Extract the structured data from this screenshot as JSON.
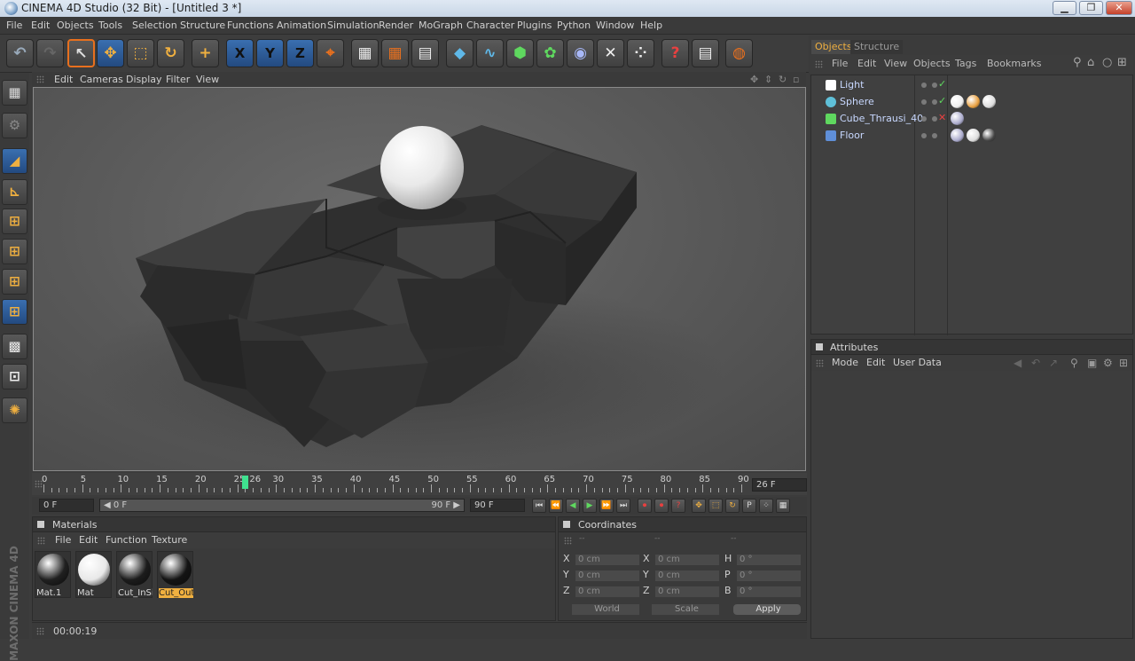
{
  "window": {
    "title": "CINEMA 4D Studio (32 Bit) - [Untitled 3 *]",
    "minimize": "▁",
    "maximize": "❐",
    "close": "✕"
  },
  "menu": [
    "File",
    "Edit",
    "Objects",
    "Tools",
    "Selection",
    "Structure",
    "Functions",
    "Animation",
    "Simulation",
    "Render",
    "MoGraph",
    "Character",
    "Plugins",
    "Python",
    "Window",
    "Help"
  ],
  "toolbar": {
    "undo": "↶",
    "redo": "↷",
    "live_select": "↖",
    "move": "✥",
    "scale": "⬚",
    "rotate": "↻",
    "add": "+",
    "x_axis": "X",
    "y_axis": "Y",
    "z_axis": "Z",
    "coord_system": "⌖",
    "render_view": "▦",
    "render_pv": "▦",
    "render_settings": "▤",
    "cube": "◆",
    "spline": "∿",
    "nurbs": "⬢",
    "array": "✿",
    "deformer": "◉",
    "scene": "✕",
    "particles": "⁘",
    "help": "?",
    "layer": "▤",
    "web": "◍"
  },
  "left_tools": [
    "▦",
    "⚙",
    "◢",
    "⊾",
    "⊞",
    "⊞",
    "⊞",
    "⊞",
    "▩",
    "⊡",
    "✺"
  ],
  "brand": "MAXON CINEMA 4D",
  "viewport": {
    "menu": [
      "Edit",
      "Cameras",
      "Display",
      "Filter",
      "View"
    ]
  },
  "timeline": {
    "labels": [
      "0",
      "5",
      "10",
      "15",
      "20",
      "25",
      "30",
      "35",
      "40",
      "45",
      "50",
      "55",
      "60",
      "65",
      "70",
      "75",
      "80",
      "85",
      "90"
    ],
    "current_label": "26",
    "current_frame": 26,
    "max_frame": 90,
    "frame_field": "26 F"
  },
  "controls": {
    "start": "0 F",
    "range_start": "◀ 0 F",
    "range_end": "90 F ▶",
    "end": "90 F",
    "playback": [
      "⏮",
      "⏪",
      "◀",
      "▶",
      "⏩",
      "⏭"
    ],
    "keys": [
      "⏺",
      "⏺",
      "?",
      "✥",
      "⬚",
      "↻",
      "P",
      "⁘",
      "▦"
    ]
  },
  "materials": {
    "title": "Materials",
    "menu": [
      "File",
      "Edit",
      "Function",
      "Texture"
    ],
    "items": [
      {
        "label": "Mat.1",
        "color": "#202020"
      },
      {
        "label": "Mat",
        "color": "#e8e8e8"
      },
      {
        "label": "Cut_InSi",
        "color": "#1c1c1c"
      },
      {
        "label": "Cut_Out.",
        "color": "#141414",
        "selected": true
      }
    ]
  },
  "coordinates": {
    "title": "Coordinates",
    "heads": [
      "--",
      "--",
      "--"
    ],
    "rows": [
      {
        "a": "X",
        "av": "0 cm",
        "b": "X",
        "bv": "0 cm",
        "c": "H",
        "cv": "0 °"
      },
      {
        "a": "Y",
        "av": "0 cm",
        "b": "Y",
        "bv": "0 cm",
        "c": "P",
        "cv": "0 °"
      },
      {
        "a": "Z",
        "av": "0 cm",
        "b": "Z",
        "bv": "0 cm",
        "c": "B",
        "cv": "0 °"
      }
    ],
    "world": "World",
    "scale": "Scale",
    "apply": "Apply"
  },
  "status": {
    "time": "00:00:19"
  },
  "objects_panel": {
    "tabs": [
      "Objects",
      "Structure"
    ],
    "menu": [
      "File",
      "Edit",
      "View",
      "Objects",
      "Tags",
      "Bookmarks"
    ],
    "items": [
      {
        "name": "Light",
        "icon_color": "#ffffff"
      },
      {
        "name": "Sphere",
        "icon_color": "#5fc0d8"
      },
      {
        "name": "Cube_Thrausi_40",
        "icon_color": "#5fd85f"
      },
      {
        "name": "Floor",
        "icon_color": "#5f8fd8"
      }
    ]
  },
  "attributes": {
    "title": "Attributes",
    "menu": [
      "Mode",
      "Edit",
      "User Data"
    ]
  },
  "colors": {
    "accent": "#e8701e",
    "selected": "#f0b040",
    "highlight": "#3a6fb0"
  }
}
